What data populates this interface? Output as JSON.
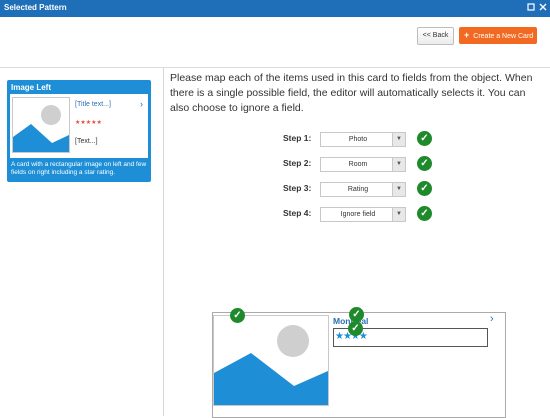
{
  "window": {
    "title": "Selected Pattern"
  },
  "toolbar": {
    "back_label": "<< Back",
    "create_label": "Create a New Card"
  },
  "pattern": {
    "name": "Image Left",
    "title_field": "[Title text...]",
    "stars": "★★★★★",
    "text_field": "[Text...]",
    "description": "A card with a rectangular image on left and few fields on right including a star rating."
  },
  "instructions": "Please map each of the items used in this card to fields from the object. When there is a single possible field, the editor will automatically selects it. You can also choose to ignore a field.",
  "steps": [
    {
      "label": "Step 1:",
      "value": "Photo"
    },
    {
      "label": "Step 2:",
      "value": "Room"
    },
    {
      "label": "Step 3:",
      "value": "Rating"
    },
    {
      "label": "Step 4:",
      "value": "Ignore field"
    }
  ],
  "preview": {
    "title": "Montreal",
    "stars": "★★★★",
    "rating_stars": 3.5
  },
  "colors": {
    "titlebar": "#1e6fb8",
    "accent": "#f26a21",
    "tile": "#1e8fd6",
    "check": "#1f8a2c",
    "link": "#2a6fb0"
  },
  "icons": {
    "maximize": "maximize-icon",
    "close": "close-icon",
    "check": "check-icon"
  }
}
